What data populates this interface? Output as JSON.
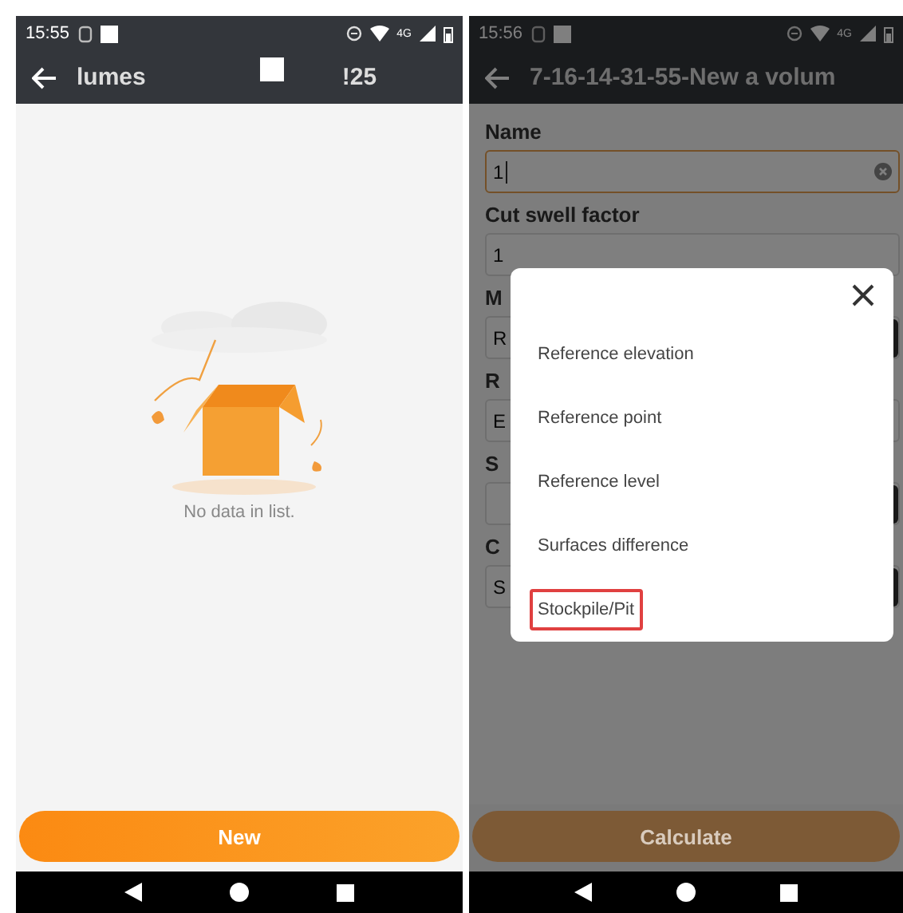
{
  "left_screen": {
    "status_bar": {
      "time": "15:55",
      "network": "4G"
    },
    "toolbar": {
      "title": "lumes",
      "title_suffix": "!25"
    },
    "empty_state": {
      "message": "No data in list."
    },
    "new_button": {
      "label": "New"
    }
  },
  "right_screen": {
    "status_bar": {
      "time": "15:56",
      "network": "4G"
    },
    "toolbar": {
      "title": "7-16-14-31-55-New a volum"
    },
    "form_fields": [
      {
        "label": "Name",
        "value": "1",
        "kind": "text",
        "focused": true
      },
      {
        "label": "Cut swell factor",
        "value": "1",
        "kind": "text",
        "focused": false
      },
      {
        "label": "M",
        "value": "R",
        "kind": "select",
        "focused": false
      },
      {
        "label": "R",
        "value": "E",
        "kind": "text",
        "focused": false
      },
      {
        "label": "S",
        "kind": "select",
        "focused": false
      },
      {
        "label": "C",
        "value": "S",
        "kind": "select",
        "focused": false
      }
    ],
    "calculate_button": {
      "label": "Calculate",
      "disabled": true
    },
    "dialog": {
      "items": [
        {
          "label": "Reference elevation",
          "selected": false
        },
        {
          "label": "Reference point",
          "selected": false
        },
        {
          "label": "Reference level",
          "selected": false
        },
        {
          "label": "Surfaces difference",
          "selected": false
        },
        {
          "label": "Stockpile/Pit",
          "selected": true
        }
      ]
    }
  }
}
